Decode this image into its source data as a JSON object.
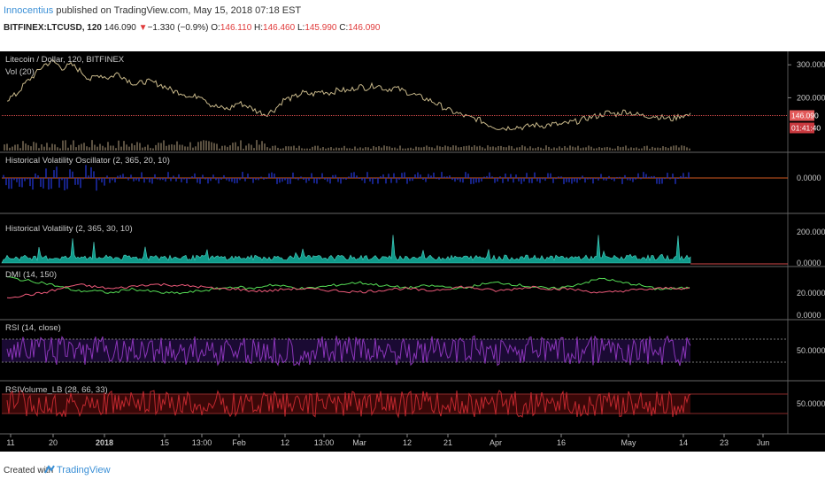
{
  "header": {
    "author": "Innocentius",
    "published": "published on TradingView.com, May 15, 2018 07:18 EST",
    "symbol": "BITFINEX:LTCUSD, 120",
    "last": "146.090",
    "arrow": "▼",
    "change": "−1.330 (−0.9%)",
    "o_label": "O:",
    "o_value": "146.110",
    "h_label": "H:",
    "h_value": "146.460",
    "l_label": "L:",
    "l_value": "145.990",
    "c_label": "C:",
    "c_value": "146.090"
  },
  "footer": {
    "created_with": "Created with",
    "brand": "TradingView"
  },
  "chart_data": [
    {
      "type": "line",
      "title": "Litecoin / Dollar, 120, BITFINEX",
      "subtitle": "Vol (20)",
      "yticks": [
        "300.000",
        "200.000",
        "100.000"
      ],
      "ylim": [
        40,
        330
      ],
      "series": [
        {
          "values": [
            195,
            210,
            245,
            270,
            300,
            310,
            290,
            300,
            280,
            255,
            270,
            260,
            275,
            255,
            240,
            250,
            245,
            235,
            220,
            215,
            200,
            210,
            180,
            170,
            165,
            185,
            175,
            160,
            150,
            165,
            195,
            200,
            215,
            210,
            220,
            215,
            225,
            220,
            235,
            230,
            240,
            225,
            230,
            220,
            210,
            200,
            190,
            175,
            160,
            150,
            140,
            135,
            120,
            110,
            108,
            112,
            110,
            118,
            115,
            120,
            118,
            125,
            130,
            140,
            145,
            155,
            150,
            160,
            150,
            145,
            145,
            140,
            135,
            147,
            146
          ]
        }
      ],
      "price_label": "146.090",
      "countdown_label": "01:41:40",
      "colors": {
        "price": "#c8b88a",
        "level": "#d34a4a",
        "badge": "#e35a5a"
      }
    },
    {
      "type": "line",
      "title": "Historical Volatility Oscillator (2, 365, 20, 10)",
      "yticks": [
        "0.0000"
      ],
      "colors": {
        "line": "#2030c0",
        "zero": "#d35a20"
      }
    },
    {
      "type": "area",
      "title": "Historical Volatility (2, 365, 30, 10)",
      "yticks": [
        "200.0000",
        "0.0000"
      ],
      "colors": {
        "fill": "#0f9a8a",
        "line": "#4fd3c4"
      }
    },
    {
      "type": "line",
      "title": "DMI (14, 150)",
      "yticks": [
        "20.0000",
        "0.0000"
      ],
      "series": [
        {
          "values": [
            35,
            32,
            30,
            26,
            22,
            22,
            20,
            24,
            22,
            20,
            20,
            22,
            24,
            26,
            24,
            28,
            26,
            24,
            26,
            28,
            30,
            28,
            26,
            25,
            27,
            26,
            24,
            28,
            30,
            28,
            26,
            24,
            26,
            30,
            34,
            30,
            28,
            24,
            24,
            25
          ]
        },
        {
          "values": [
            16,
            18,
            20,
            24,
            28,
            26,
            24,
            26,
            28,
            28,
            27,
            26,
            24,
            24,
            22,
            22,
            24,
            24,
            23,
            22,
            21,
            22,
            24,
            24,
            22,
            24,
            26,
            24,
            22,
            24,
            26,
            24,
            24,
            22,
            20,
            22,
            23,
            24,
            25,
            24
          ]
        }
      ],
      "colors": {
        "plus": "#55dd55",
        "minus": "#ee5a7a"
      }
    },
    {
      "type": "line",
      "title": "RSI (14, close)",
      "yticks": [
        "50.0000"
      ],
      "colors": {
        "line": "#8a35b8",
        "band": "#1a0a33"
      }
    },
    {
      "type": "line",
      "title": "RSIVolume_LB (28, 66, 33)",
      "yticks": [
        "50.0000"
      ],
      "colors": {
        "line": "#c0282e",
        "band": "#3a0808"
      }
    }
  ],
  "x_axis": {
    "ticks": [
      "11",
      "20",
      "2018",
      "15",
      "13:00",
      "Feb",
      "12",
      "13:00",
      "Mar",
      "12",
      "21",
      "Apr",
      "16",
      "May",
      "14",
      "23",
      "Jun"
    ],
    "bold": [
      "2018"
    ]
  }
}
